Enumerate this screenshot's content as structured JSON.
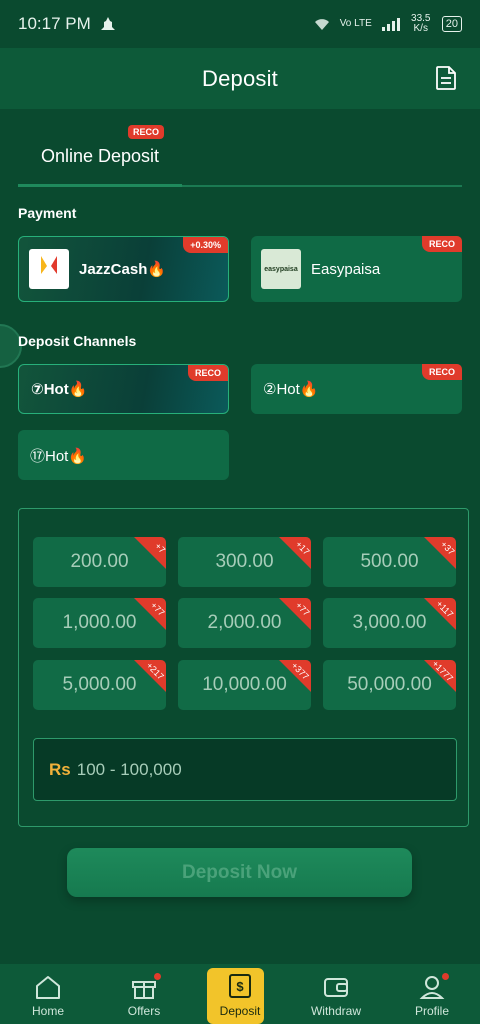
{
  "status_bar": {
    "time": "10:17 PM",
    "network": "Vo LTE",
    "speed": "33.5 K/s",
    "battery": "20"
  },
  "header": {
    "title": "Deposit",
    "doc_icon": "document-icon"
  },
  "tabs": [
    {
      "label": "Online Deposit",
      "badge": "RECO"
    }
  ],
  "payment": {
    "label": "Payment",
    "methods": [
      {
        "name": "JazzCash🔥",
        "badge": "+0.30%",
        "logo_text": "JazzCash"
      },
      {
        "name": "Easypaisa",
        "badge": "RECO",
        "logo_text": "easypaisa"
      }
    ]
  },
  "channels": {
    "label": "Deposit Channels",
    "items": [
      {
        "label": "⑦Hot🔥",
        "badge": "RECO"
      },
      {
        "label": "②Hot🔥",
        "badge": "RECO"
      },
      {
        "label": "⑰Hot🔥",
        "badge": ""
      }
    ]
  },
  "amounts": [
    {
      "value": "200.00",
      "bonus": "+7"
    },
    {
      "value": "300.00",
      "bonus": "+17"
    },
    {
      "value": "500.00",
      "bonus": "+37"
    },
    {
      "value": "1,000.00",
      "bonus": "+77"
    },
    {
      "value": "2,000.00",
      "bonus": "+77"
    },
    {
      "value": "3,000.00",
      "bonus": "+117"
    },
    {
      "value": "5,000.00",
      "bonus": "+217"
    },
    {
      "value": "10,000.00",
      "bonus": "+377"
    },
    {
      "value": "50,000.00",
      "bonus": "+1777"
    }
  ],
  "amount_input": {
    "currency": "Rs",
    "placeholder": "100 - 100,000"
  },
  "deposit_button": "Deposit Now",
  "bottom_nav": [
    {
      "label": "Home",
      "icon": "home-icon"
    },
    {
      "label": "Offers",
      "icon": "gift-icon"
    },
    {
      "label": "Deposit",
      "icon": "deposit-wallet-icon"
    },
    {
      "label": "Withdraw",
      "icon": "wallet-icon"
    },
    {
      "label": "Profile",
      "icon": "profile-icon"
    }
  ],
  "colors": {
    "background": "#0a4a2f",
    "accent": "#f2c42a",
    "badge": "#e03b2b"
  }
}
